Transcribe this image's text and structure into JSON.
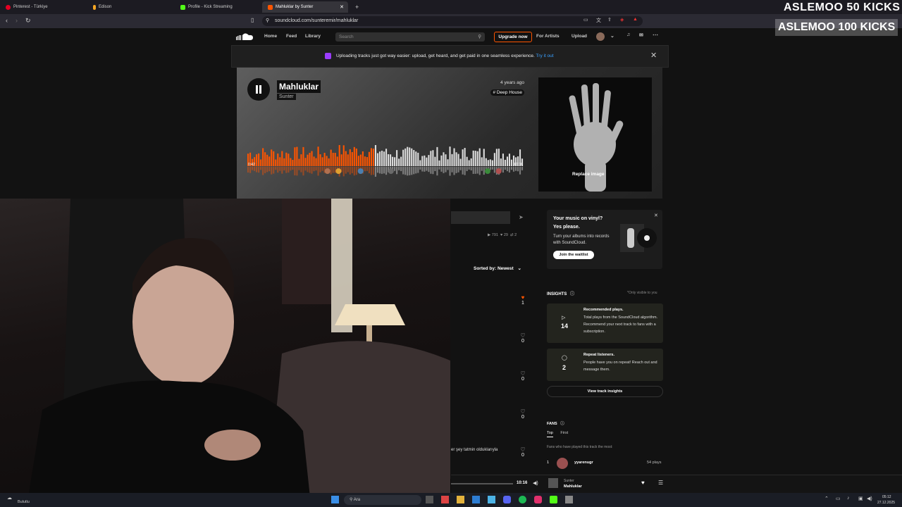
{
  "browser": {
    "tabs": [
      {
        "label": "Pinterest - Türkiye",
        "color": "#e60023"
      },
      {
        "label": "Edison",
        "color": "#f5a623"
      },
      {
        "label": "Profile - Kick Streaming",
        "color": "#53fc18"
      },
      {
        "label": "Mahluklar by Sunter",
        "color": "#ff5500"
      }
    ],
    "new_tab": "+",
    "url": "soundcloud.com/sunteremir/mahluklar"
  },
  "nav": {
    "home": "Home",
    "feed": "Feed",
    "library": "Library",
    "search_placeholder": "Search",
    "upgrade": "Upgrade now",
    "for_artists": "For Artists",
    "upload": "Upload"
  },
  "banner": {
    "text": "Uploading tracks just got way easier: upload, get heard, and get paid in one seamless experience.",
    "link": "Try it out"
  },
  "track": {
    "title": "Mahluklar",
    "artist": "Sunter",
    "posted": "4 years ago",
    "genre": "# Deep House",
    "replace_image": "Replace image",
    "played_time": "0:42",
    "duration": "10:16",
    "progress": 0.46,
    "colors": {
      "played": "#ff5500",
      "unplayed": "#dcdcdc"
    }
  },
  "stats": {
    "plays": "791",
    "likes": "29",
    "reposts": "2"
  },
  "comments": {
    "sorted_by": "Sorted by: Newest",
    "likes": [
      "1",
      "0",
      "0",
      "0",
      "0"
    ],
    "snippet": "er şey tatmin olduklarıyla"
  },
  "vinyl": {
    "title": "Your music on vinyl?",
    "sub": "Yes please.",
    "body": "Turn your albums into records with SoundCloud.",
    "button": "Join the waitlist"
  },
  "insights": {
    "heading": "INSIGHTS",
    "note": "*Only visible to you",
    "cards": [
      {
        "number": "14",
        "title": "Recommended plays.",
        "desc": "Total plays from the SoundCloud algorithm. Recommend your next track to fans with a subscription."
      },
      {
        "number": "2",
        "title": "Repeat listeners.",
        "desc": "People have you on repeat! Reach out and message them."
      }
    ],
    "view_button": "View track insights"
  },
  "fans": {
    "heading": "FANS",
    "tabs": [
      "Top",
      "First"
    ],
    "note": "Fans who have played this track the most:",
    "rank": "1",
    "name": "yyarenugr",
    "plays": "54 plays"
  },
  "player": {
    "time": "10:16",
    "artist": "Sunter",
    "title": "Mahluklar"
  },
  "taskbar": {
    "weather": "Bulutlu",
    "search": "Ara",
    "time": "05:12",
    "date": "27.12.2025"
  },
  "overlay": {
    "line1": "ASLEMOO  50 KICKS",
    "line2": "ASLEMOO  100 KICKS"
  }
}
